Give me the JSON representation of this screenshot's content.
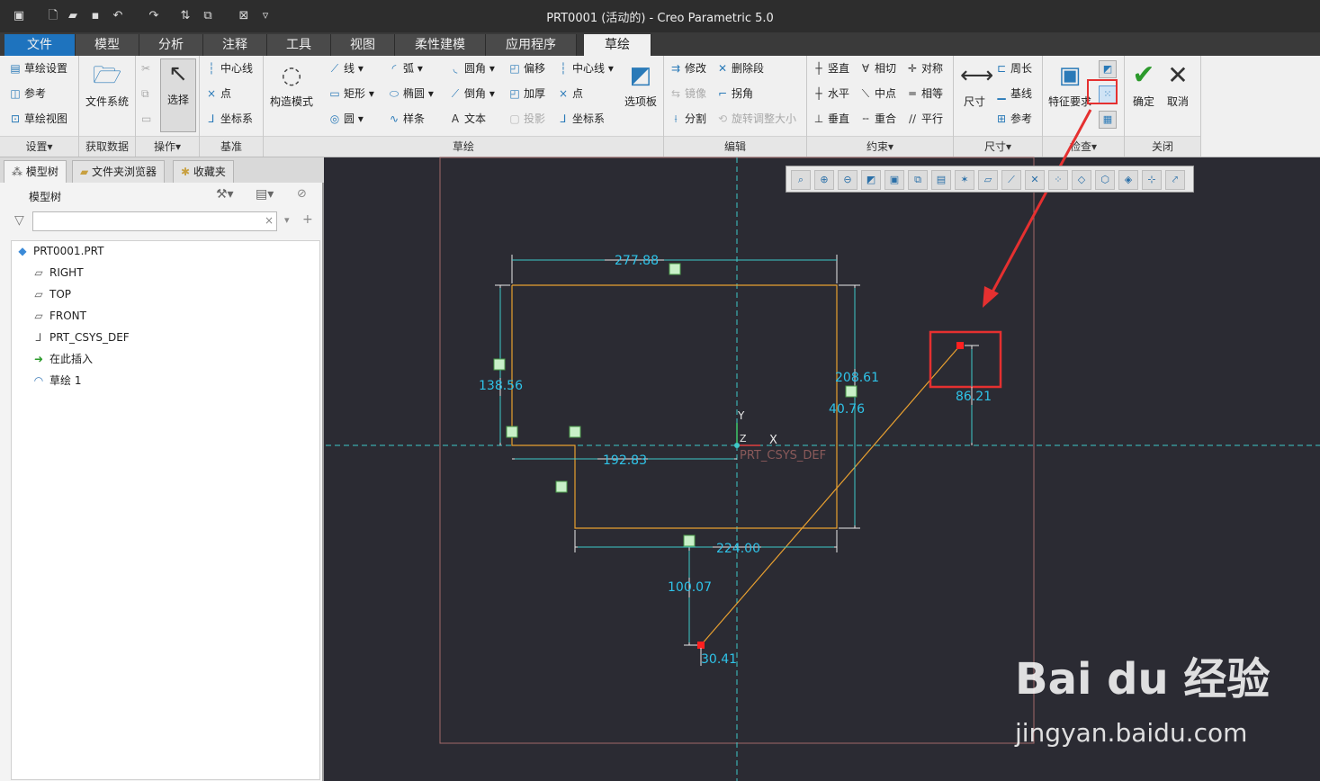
{
  "window": {
    "title": "PRT0001 (活动的) - Creo Parametric 5.0"
  },
  "menu_tabs": [
    "文件",
    "模型",
    "分析",
    "注释",
    "工具",
    "视图",
    "柔性建模",
    "应用程序",
    "草绘"
  ],
  "active_tab": "草绘",
  "ribbon": {
    "settings": {
      "label": "设置▾",
      "items": [
        "草绘设置",
        "参考",
        "草绘视图"
      ]
    },
    "get_data": {
      "label": "获取数据",
      "file_system": "文件系统"
    },
    "operations": {
      "label": "操作▾",
      "select": "选择"
    },
    "datum": {
      "label": "基准",
      "items": [
        "中心线",
        "点",
        "坐标系"
      ]
    },
    "sketch": {
      "label": "草绘",
      "construction_mode": "构造模式",
      "col1": [
        "线",
        "矩形",
        "圆"
      ],
      "col2": [
        "弧",
        "椭圆",
        "样条"
      ],
      "col3": [
        "圆角",
        "倒角",
        "文本"
      ],
      "col4": [
        "偏移",
        "加厚",
        "投影"
      ],
      "col5": [
        "中心线",
        "点",
        "坐标系"
      ],
      "palette": "选项板"
    },
    "edit": {
      "label": "编辑",
      "col1": [
        "修改",
        "镜像",
        "分割"
      ],
      "col2": [
        "删除段",
        "拐角",
        "旋转调整大小"
      ]
    },
    "constrain": {
      "label": "约束▾",
      "col1": [
        "竖直",
        "水平",
        "垂直"
      ],
      "col2": [
        "相切",
        "中点",
        "重合"
      ],
      "col3": [
        "对称",
        "相等",
        "平行"
      ]
    },
    "dimension": {
      "label": "尺寸▾",
      "dimension": "尺寸",
      "items": [
        "周长",
        "基线",
        "参考"
      ]
    },
    "inspect": {
      "label": "检查▾",
      "feature_req": "特征要求"
    },
    "close": {
      "label": "关闭",
      "ok": "确定",
      "cancel": "取消"
    }
  },
  "left_panel": {
    "tabs": [
      "模型树",
      "文件夹浏览器",
      "收藏夹"
    ],
    "header": "模型树",
    "search_placeholder": "",
    "tree": [
      "PRT0001.PRT",
      "RIGHT",
      "TOP",
      "FRONT",
      "PRT_CSYS_DEF",
      "在此插入",
      "草绘 1"
    ]
  },
  "sketch_dims": [
    "277.88",
    "138.56",
    "208.61",
    "40.76",
    "192.83",
    "224.00",
    "100.07",
    "86.21",
    "30.41"
  ],
  "csys_label": "PRT_CSYS_DEF",
  "axis_labels": {
    "y": "Y",
    "x": "X",
    "z": "Z"
  },
  "watermark": {
    "brand": "Bai du 经验",
    "url": "jingyan.baidu.com"
  },
  "colors": {
    "canvas": "#2b2b33",
    "sketch_line": "#e8a030",
    "dim": "#2fc3e8",
    "highlight": "#e53030"
  }
}
